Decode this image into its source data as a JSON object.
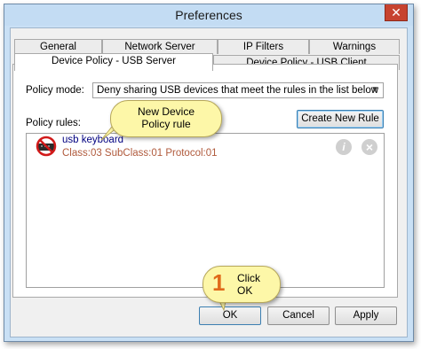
{
  "window": {
    "title": "Preferences",
    "close_glyph": "✕"
  },
  "tabs": {
    "row1": [
      "General",
      "Network Server",
      "IP Filters",
      "Warnings"
    ],
    "row2": [
      "Device Policy - USB Server",
      "Device Policy - USB Client"
    ],
    "active": "Device Policy - USB Server"
  },
  "policy_mode": {
    "label": "Policy mode:",
    "value": "Deny sharing USB devices that meet the rules in the list below"
  },
  "policy_rules": {
    "label": "Policy rules:",
    "new_rule_button": "Create New Rule",
    "rules": [
      {
        "name": "usb keyboard",
        "description": "Class:03  SubClass:01  Protocol:01",
        "icon": "usb-keyboard-denied-icon"
      }
    ],
    "edit_icon_glyph": "i",
    "delete_icon_glyph": "×"
  },
  "buttons": {
    "ok": "OK",
    "cancel": "Cancel",
    "apply": "Apply"
  },
  "callouts": {
    "new_rule": [
      "New Device",
      "Policy rule"
    ],
    "step_number": "1",
    "click_ok": [
      "Click",
      "OK"
    ]
  },
  "colors": {
    "callout_bg": "#fdf7a8",
    "step_number": "#e06a1a",
    "close_button": "#c7432f",
    "rule_name": "#000080",
    "rule_desc": "#b05a3c"
  }
}
